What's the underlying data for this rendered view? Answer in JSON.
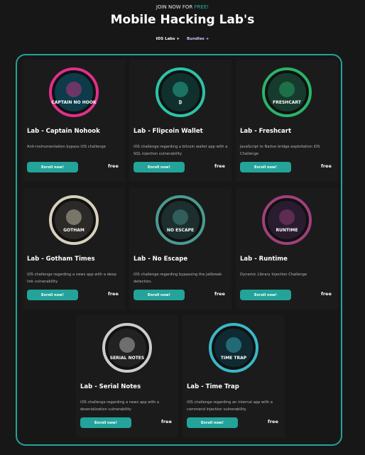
{
  "header": {
    "join_prefix": "JOIN NOW FOR ",
    "join_free": "FREE!",
    "title": "Mobile Hacking Lab's"
  },
  "filters": [
    {
      "label": "iOS Labs +"
    },
    {
      "label": "Bundles +"
    }
  ],
  "labs": [
    {
      "title": "Lab - Captain Nohook",
      "desc": "Anti-instrumentation bypass iOS challenge",
      "enroll": "Enroll now!",
      "price": "free",
      "badge_text": "CAPTAIN NO HOOK",
      "ring": "#e0308a",
      "inner": "#0d3b4a"
    },
    {
      "title": "Lab - Flipcoin Wallet",
      "desc": "iOS challenge regarding a bitcoin wallet app with a SQL injection vulnerability",
      "enroll": "Enroll now!",
      "price": "free",
      "badge_text": "₿",
      "ring": "#2bc3a8",
      "inner": "#10302e"
    },
    {
      "title": "Lab - Freshcart",
      "desc": "JavaScript to Native bridge exploitation iOS Challenge",
      "enroll": "Enroll now!",
      "price": "free",
      "badge_text": "FRESHCART",
      "ring": "#29b46a",
      "inner": "#173a2e"
    },
    {
      "title": "Lab - Gotham Times",
      "desc": "iOS challenge regarding a news app with a deep link vulnerability",
      "enroll": "Enroll now!",
      "price": "free",
      "badge_text": "GOTHAM",
      "ring": "#d8d0bc",
      "inner": "#2b2a26"
    },
    {
      "title": "Lab - No Escape",
      "desc": "iOS challenge regarding bypassing the jailbreak detection.",
      "enroll": "Enroll now!",
      "price": "free",
      "badge_text": "NO ESCAPE",
      "ring": "#4a9a90",
      "inner": "#1c2e2e"
    },
    {
      "title": "Lab - Runtime",
      "desc": "Dynamic Library Injection Challenge",
      "enroll": "Enroll now!",
      "price": "free",
      "badge_text": "RUNTIME",
      "ring": "#a0407a",
      "inner": "#2a1c30"
    },
    {
      "title": "Lab - Serial Notes",
      "desc": "iOS challenge regarding a news app with a deserialization vulnerability",
      "enroll": "Enroll now!",
      "price": "free",
      "badge_text": "SERIAL NOTES",
      "ring": "#cccccc",
      "inner": "#222"
    },
    {
      "title": "Lab - Time Trap",
      "desc": "iOS challenge regarding an internal app with a command injection vulnerability",
      "enroll": "Enroll now!",
      "price": "free",
      "badge_text": "TIME TRAP",
      "ring": "#3ab8c8",
      "inner": "#0f2a33"
    }
  ]
}
